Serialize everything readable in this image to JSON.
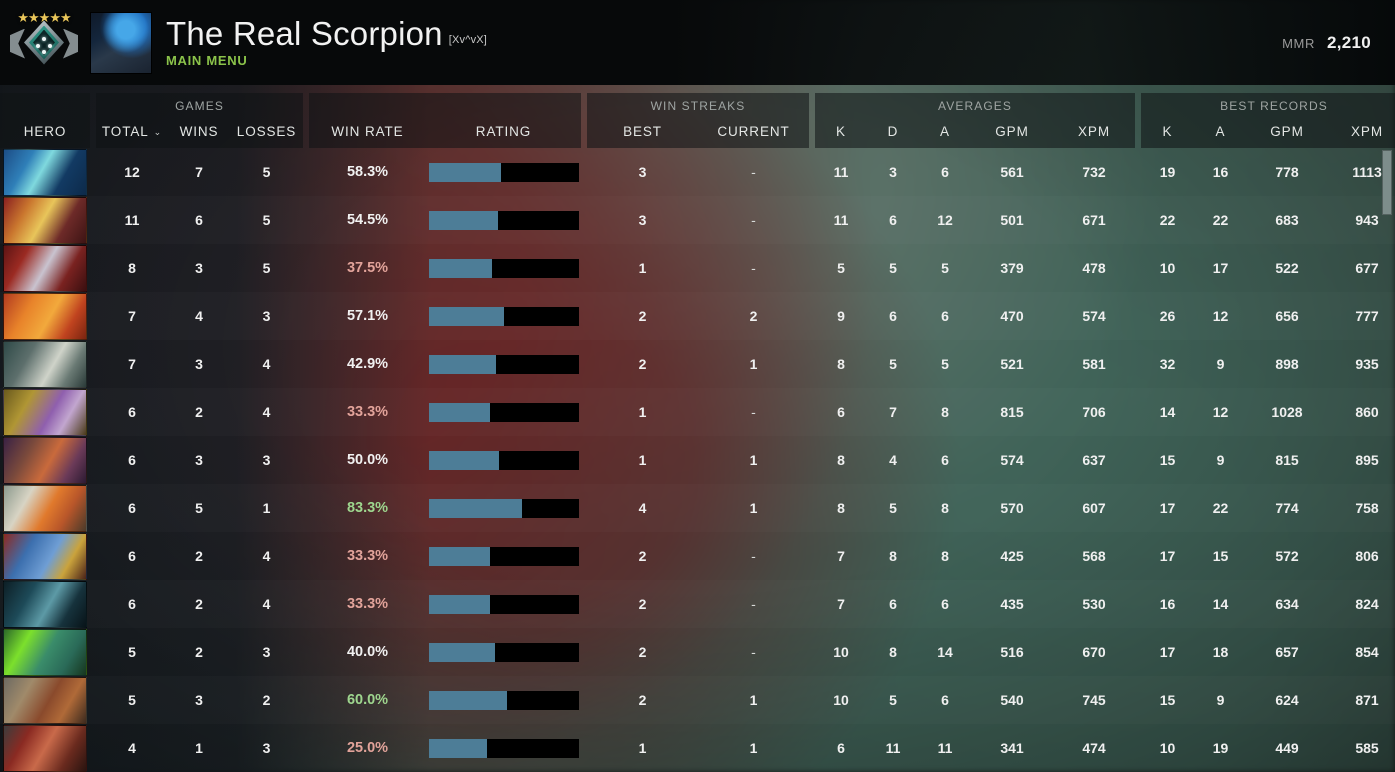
{
  "topbar": {
    "rank_stars": "★★★★★",
    "player_name": "The Real Scorpion",
    "player_tag": "[Xv^vX]",
    "menu_label": "MAIN MENU",
    "mmr_label": "MMR",
    "mmr_value": "2,210",
    "accent_green": "#8bc34a"
  },
  "header": {
    "hero": "HERO",
    "games_group": "GAMES",
    "games_cols": [
      "TOTAL",
      "WINS",
      "LOSSES"
    ],
    "sort_caret": "⌄",
    "win_rate": "WIN RATE",
    "rating": "RATING",
    "streaks_group": "WIN STREAKS",
    "streaks_cols": [
      "BEST",
      "CURRENT"
    ],
    "averages_group": "AVERAGES",
    "averages_cols": [
      "K",
      "D",
      "A",
      "GPM",
      "XPM"
    ],
    "records_group": "BEST RECORDS",
    "records_cols": [
      "K",
      "A",
      "GPM",
      "XPM"
    ]
  },
  "colors": {
    "bar_fill": "#4d7d97",
    "bar_track": "#000000",
    "win_high": "#9ed68e",
    "win_low": "#e2a39a",
    "win_even": "#f1f1f1"
  },
  "rows": [
    {
      "hero": "morphling",
      "total": "12",
      "wins": "7",
      "losses": "5",
      "win_rate": "58.3%",
      "wr_state": "even",
      "rating_pct": 48,
      "best_streak": "3",
      "current_streak": "-",
      "k": "11",
      "d": "3",
      "a": "6",
      "gpm": "561",
      "xpm": "732",
      "best_k": "19",
      "best_a": "16",
      "best_gpm": "778",
      "best_xpm": "1113",
      "portrait": "linear-gradient(120deg,#1c4d86 0%,#2f7fb8 28%,#7fd9de 46%,#123a63 70%,#0d2a4a 100%)"
    },
    {
      "hero": "legion-commander",
      "total": "11",
      "wins": "6",
      "losses": "5",
      "win_rate": "54.5%",
      "wr_state": "even",
      "rating_pct": 46,
      "best_streak": "3",
      "current_streak": "-",
      "k": "11",
      "d": "6",
      "a": "12",
      "gpm": "501",
      "xpm": "671",
      "best_k": "22",
      "best_a": "22",
      "best_gpm": "683",
      "best_xpm": "943",
      "portrait": "linear-gradient(120deg,#8a2020 0%,#c9752e 26%,#e8c55a 48%,#6d2a28 72%,#3d1414 100%)"
    },
    {
      "hero": "queen-of-pain",
      "total": "8",
      "wins": "3",
      "losses": "5",
      "win_rate": "37.5%",
      "wr_state": "down",
      "rating_pct": 42,
      "best_streak": "1",
      "current_streak": "-",
      "k": "5",
      "d": "5",
      "a": "5",
      "gpm": "379",
      "xpm": "478",
      "best_k": "10",
      "best_a": "17",
      "best_gpm": "522",
      "best_xpm": "677",
      "portrait": "linear-gradient(120deg,#5e1414 0%,#9b2a22 24%,#c9c3cf 50%,#7a2220 74%,#3a0f10 100%)"
    },
    {
      "hero": "lina",
      "total": "7",
      "wins": "4",
      "losses": "3",
      "win_rate": "57.1%",
      "wr_state": "even",
      "rating_pct": 50,
      "best_streak": "2",
      "current_streak": "2",
      "k": "9",
      "d": "6",
      "a": "6",
      "gpm": "470",
      "xpm": "574",
      "best_k": "26",
      "best_a": "12",
      "best_gpm": "656",
      "best_xpm": "777",
      "portrait": "linear-gradient(120deg,#b23b20 0%,#e8832a 30%,#f2a93c 55%,#c0431f 78%,#7a2410 100%)"
    },
    {
      "hero": "magnus",
      "total": "7",
      "wins": "3",
      "losses": "4",
      "win_rate": "42.9%",
      "wr_state": "even",
      "rating_pct": 45,
      "best_streak": "2",
      "current_streak": "1",
      "k": "8",
      "d": "5",
      "a": "5",
      "gpm": "521",
      "xpm": "581",
      "best_k": "32",
      "best_a": "9",
      "best_gpm": "898",
      "best_xpm": "935",
      "portrait": "linear-gradient(120deg,#2f4a48 0%,#5d6f6c 30%,#cfd3c9 58%,#6a7a74 78%,#2a3a38 100%)"
    },
    {
      "hero": "alchemist",
      "total": "6",
      "wins": "2",
      "losses": "4",
      "win_rate": "33.3%",
      "wr_state": "down",
      "rating_pct": 41,
      "best_streak": "1",
      "current_streak": "-",
      "k": "6",
      "d": "7",
      "a": "8",
      "gpm": "815",
      "xpm": "706",
      "best_k": "14",
      "best_a": "12",
      "best_gpm": "1028",
      "best_xpm": "860",
      "portrait": "linear-gradient(120deg,#6a5a1e 0%,#b09634 28%,#8f5fae 56%,#c2a6cf 74%,#4a3a18 100%)"
    },
    {
      "hero": "anti-mage",
      "total": "6",
      "wins": "3",
      "losses": "3",
      "win_rate": "50.0%",
      "wr_state": "even",
      "rating_pct": 47,
      "best_streak": "1",
      "current_streak": "1",
      "k": "8",
      "d": "4",
      "a": "6",
      "gpm": "574",
      "xpm": "637",
      "best_k": "15",
      "best_a": "9",
      "best_gpm": "815",
      "best_xpm": "895",
      "portrait": "linear-gradient(120deg,#3a2244 0%,#7b4a3c 30%,#c96a3c 55%,#6b3a58 78%,#2c1a32 100%)"
    },
    {
      "hero": "juggernaut",
      "total": "6",
      "wins": "5",
      "losses": "1",
      "win_rate": "83.3%",
      "wr_state": "up",
      "rating_pct": 62,
      "best_streak": "4",
      "current_streak": "1",
      "k": "8",
      "d": "5",
      "a": "8",
      "gpm": "570",
      "xpm": "607",
      "best_k": "17",
      "best_a": "22",
      "best_gpm": "774",
      "best_xpm": "758",
      "portrait": "linear-gradient(120deg,#8c9a8e 0%,#d8d4c4 28%,#e0792c 54%,#b8562a 74%,#4a3a2a 100%)"
    },
    {
      "hero": "ogre-magi",
      "total": "6",
      "wins": "2",
      "losses": "4",
      "win_rate": "33.3%",
      "wr_state": "down",
      "rating_pct": 41,
      "best_streak": "2",
      "current_streak": "-",
      "k": "7",
      "d": "8",
      "a": "8",
      "gpm": "425",
      "xpm": "568",
      "best_k": "17",
      "best_a": "15",
      "best_gpm": "572",
      "best_xpm": "806",
      "portrait": "linear-gradient(120deg,#8d2a22 0%,#3c6fae 30%,#6f9ed4 56%,#caa33c 76%,#4a2218 100%)"
    },
    {
      "hero": "phantom-assassin",
      "total": "6",
      "wins": "2",
      "losses": "4",
      "win_rate": "33.3%",
      "wr_state": "down",
      "rating_pct": 41,
      "best_streak": "2",
      "current_streak": "-",
      "k": "7",
      "d": "6",
      "a": "6",
      "gpm": "435",
      "xpm": "530",
      "best_k": "16",
      "best_a": "14",
      "best_gpm": "634",
      "best_xpm": "824",
      "portrait": "linear-gradient(120deg,#0d1f26 0%,#1d4a58 30%,#5d9aa6 54%,#16323c 76%,#081318 100%)"
    },
    {
      "hero": "razor",
      "total": "5",
      "wins": "2",
      "losses": "3",
      "win_rate": "40.0%",
      "wr_state": "even",
      "rating_pct": 44,
      "best_streak": "2",
      "current_streak": "-",
      "k": "10",
      "d": "8",
      "a": "14",
      "gpm": "516",
      "xpm": "670",
      "best_k": "17",
      "best_a": "18",
      "best_gpm": "657",
      "best_xpm": "854",
      "portrait": "linear-gradient(120deg,#2c6a2a 0%,#7ce02c 26%,#3a8c6a 52%,#2a6a58 76%,#16361e 100%)"
    },
    {
      "hero": "lycan",
      "total": "5",
      "wins": "3",
      "losses": "2",
      "win_rate": "60.0%",
      "wr_state": "up",
      "rating_pct": 52,
      "best_streak": "2",
      "current_streak": "1",
      "k": "10",
      "d": "5",
      "a": "6",
      "gpm": "540",
      "xpm": "745",
      "best_k": "15",
      "best_a": "9",
      "best_gpm": "624",
      "best_xpm": "871",
      "portrait": "linear-gradient(120deg,#6d6a62 0%,#a08a6a 28%,#8a4a2c 54%,#b06a38 74%,#3c2a1e 100%)"
    },
    {
      "hero": "doom",
      "total": "4",
      "wins": "1",
      "losses": "3",
      "win_rate": "25.0%",
      "wr_state": "down",
      "rating_pct": 39,
      "best_streak": "1",
      "current_streak": "1",
      "k": "6",
      "d": "11",
      "a": "11",
      "gpm": "341",
      "xpm": "474",
      "best_k": "10",
      "best_a": "19",
      "best_gpm": "449",
      "best_xpm": "585",
      "portrait": "linear-gradient(120deg,#3c3c3c 0%,#8a2a22 26%,#c96a4a 50%,#6a2a1e 76%,#2a1410 100%)"
    }
  ],
  "scrollbar": {
    "thumb_top": 0,
    "thumb_height": 65
  }
}
